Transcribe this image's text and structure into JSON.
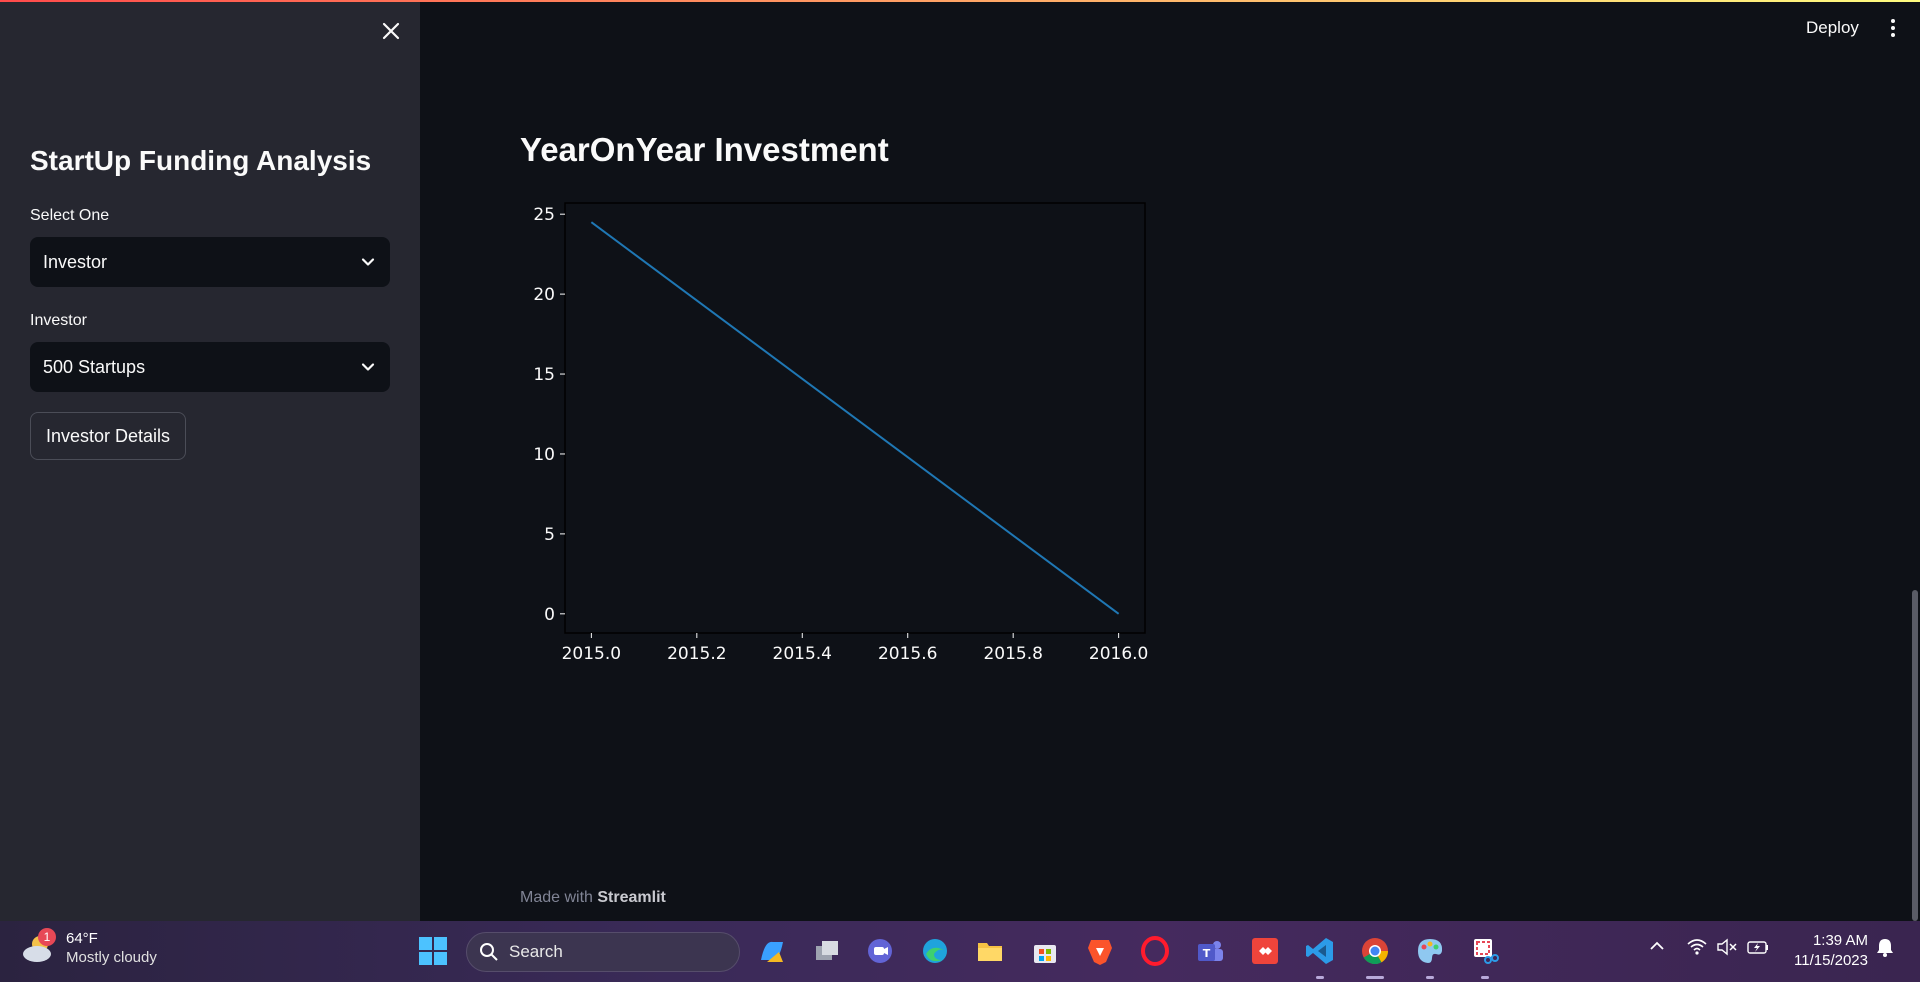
{
  "sidebar": {
    "title": "StartUp Funding Analysis",
    "select_one_label": "Select One",
    "select_one_value": "Investor",
    "investor_label": "Investor",
    "investor_value": "500 Startups",
    "button_label": "Investor Details"
  },
  "header": {
    "deploy_label": "Deploy"
  },
  "main": {
    "title": "YearOnYear Investment",
    "footer_prefix": "Made with",
    "footer_brand": "Streamlit"
  },
  "chart_data": {
    "type": "line",
    "x": [
      2015.0,
      2016.0
    ],
    "series": [
      {
        "values": [
          24.5,
          0
        ],
        "color": "#1f77b4"
      }
    ],
    "xticks": [
      "2015.0",
      "2015.2",
      "2015.4",
      "2015.6",
      "2015.8",
      "2016.0"
    ],
    "yticks": [
      "0",
      "5",
      "10",
      "15",
      "20",
      "25"
    ],
    "xlim": [
      2014.95,
      2016.05
    ],
    "ylim": [
      -1.2,
      25.7
    ],
    "title": "",
    "xlabel": "",
    "ylabel": "",
    "grid": false
  },
  "taskbar": {
    "weather_temp": "64°F",
    "weather_desc": "Mostly cloudy",
    "weather_badge": "1",
    "search_label": "Search",
    "time": "1:39 AM",
    "date": "11/15/2023"
  },
  "colors": {
    "app_bg": "#0e1117",
    "sidebar_bg": "#262730",
    "line": "#1f77b4"
  }
}
